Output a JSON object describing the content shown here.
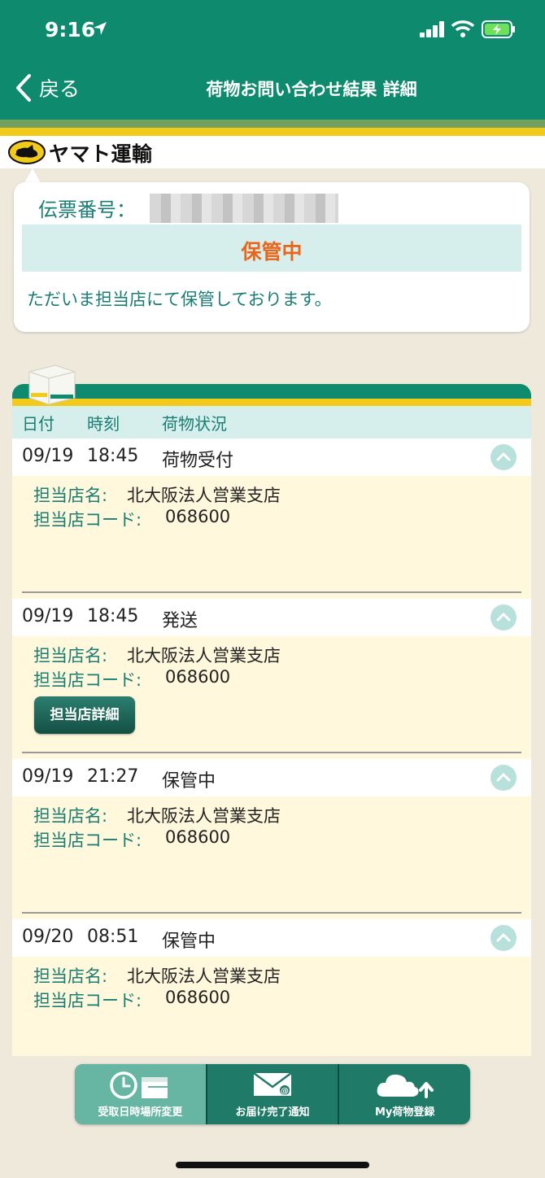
{
  "status_bar": {
    "time": "9:16"
  },
  "nav": {
    "back_label": "戻る",
    "title": "荷物お問い合わせ結果 詳細"
  },
  "brand": {
    "logo_text": "ヤマト運輸"
  },
  "info": {
    "slip_label": "伝票番号：",
    "status": "保管中",
    "message": "ただいま担当店にて保管しております。"
  },
  "timeline": {
    "headers": {
      "date": "日付",
      "time": "時刻",
      "status": "荷物状況"
    },
    "store_name_label": "担当店名:",
    "store_code_label": "担当店コード:",
    "store_detail_button": "担当店詳細",
    "entries": [
      {
        "date": "09/19",
        "time": "18:45",
        "status": "荷物受付",
        "store_name": "北大阪法人営業支店",
        "store_code": "068600"
      },
      {
        "date": "09/19",
        "time": "18:45",
        "status": "発送",
        "store_name": "北大阪法人営業支店",
        "store_code": "068600"
      },
      {
        "date": "09/19",
        "time": "21:27",
        "status": "保管中",
        "store_name": "北大阪法人営業支店",
        "store_code": "068600"
      },
      {
        "date": "09/20",
        "time": "08:51",
        "status": "保管中",
        "store_name": "北大阪法人営業支店",
        "store_code": "068600"
      }
    ]
  },
  "toolbar": {
    "items": [
      {
        "label": "受取日時場所変更",
        "icon": "clock-calendar-icon",
        "active": true
      },
      {
        "label": "お届け完了通知",
        "icon": "mail-icon",
        "active": false
      },
      {
        "label": "My荷物登録",
        "icon": "cloud-upload-icon",
        "active": false
      }
    ]
  },
  "colors": {
    "brand_green": "#0e8a6e",
    "brand_yellow": "#f2cb1a",
    "status_orange": "#e8661c",
    "label_teal": "#1a7d73"
  }
}
